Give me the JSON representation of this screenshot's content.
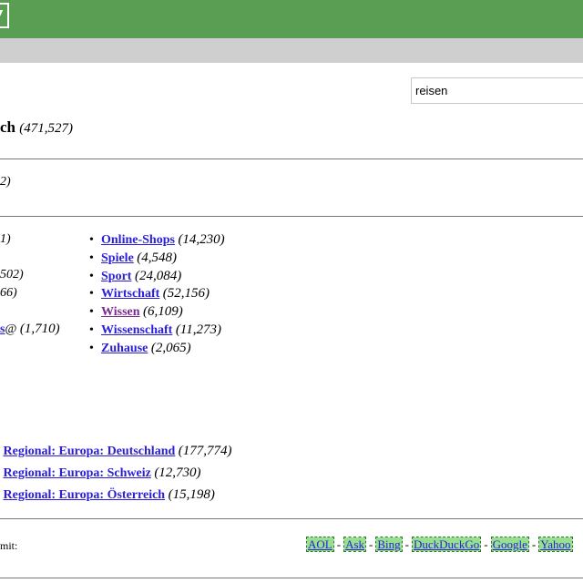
{
  "header": {
    "logo_icon": "logo-icon"
  },
  "search": {
    "value": "reisen"
  },
  "title": {
    "text": "ch",
    "count": "(471,527)"
  },
  "row2": {
    "fragment": "2)"
  },
  "col1": [
    {
      "fragment": "1)"
    },
    {
      "fragment": "502)"
    },
    {
      "fragment": "66)"
    },
    {
      "fragment": ""
    },
    {
      "link": "s",
      "suffix": "@",
      "count": "(1,710)"
    }
  ],
  "col2": [
    {
      "label": "Online-Shops",
      "count": "(14,230)"
    },
    {
      "label": "Spiele",
      "count": "(4,548)"
    },
    {
      "label": "Sport",
      "count": "(24,084)"
    },
    {
      "label": "Wirtschaft",
      "count": "(52,156)"
    },
    {
      "label": "Wissen",
      "count": "(6,109)"
    },
    {
      "label": "Wissenschaft",
      "count": "(11,273)"
    },
    {
      "label": "Zuhause",
      "count": "(2,065)"
    }
  ],
  "regional": [
    {
      "label": "Regional: Europa: Deutschland",
      "count": "(177,774)"
    },
    {
      "label": "Regional: Europa: Schweiz",
      "count": "(12,730)"
    },
    {
      "label": "Regional: Europa: Österreich",
      "count": "(15,198)"
    }
  ],
  "footer": {
    "prefix": "mit:",
    "engines": [
      "AOL",
      "Ask",
      "Bing",
      "DuckDuckGo",
      "Google",
      "Yahoo"
    ]
  },
  "colors": {
    "topbar": "#5a9e54",
    "subbar": "#cfcfcf",
    "link": "#2a1fd6",
    "visited": "#7a2a8e",
    "engine_bg": "#96e08f"
  }
}
